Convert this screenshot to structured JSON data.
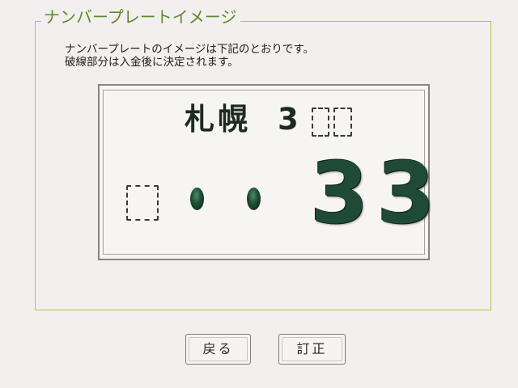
{
  "group": {
    "title": "ナンバープレートイメージ"
  },
  "message": {
    "line1": "ナンバープレートのイメージは下記のとおりです。",
    "line2": "破線部分は入金後に決定されます。"
  },
  "plate": {
    "region": "札幌",
    "class_number": "3",
    "serial_number": "33",
    "dot_color": "#1c4a33",
    "number_color": "#1f4b36"
  },
  "buttons": {
    "back_label": "戻る",
    "correct_label": "訂正"
  }
}
